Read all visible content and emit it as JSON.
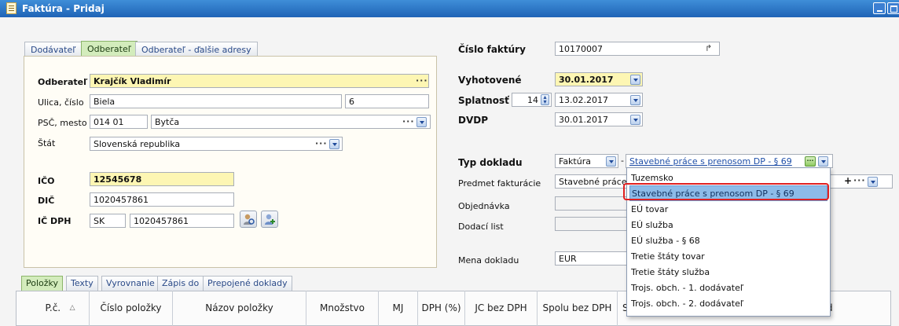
{
  "window": {
    "title": "Faktúra - Pridaj"
  },
  "tabs_top": [
    "Dodávateľ",
    "Odberateľ",
    "Odberateľ - ďalšie adresy"
  ],
  "customer": {
    "odberatel_label": "Odberateľ",
    "odberatel_value": "Krajčík Vladimír",
    "street_label": "Ulica, číslo",
    "street_value": "Biela",
    "street_number": "6",
    "psc_label": "PSČ, mesto",
    "psc_value": "014 01",
    "city_value": "Bytča",
    "country_label": "Štát",
    "country_value": "Slovenská republika",
    "ico_label": "IČO",
    "ico_value": "12545678",
    "dic_label": "DIČ",
    "dic_value": "1020457861",
    "icdph_label": "IČ DPH",
    "icdph_prefix": "SK",
    "icdph_value": "1020457861"
  },
  "invoice": {
    "number_label": "Číslo faktúry",
    "number_value": "10170007",
    "issued_label": "Vyhotovené",
    "issued_value": "30.01.2017",
    "due_label": "Splatnosť",
    "due_days": "14",
    "due_value": "13.02.2017",
    "dvdp_label": "DVDP",
    "dvdp_value": "30.01.2017",
    "doc_type_label": "Typ dokladu",
    "doc_type_value": "Faktúra",
    "doc_subtype_value": "Stavebné práce s prenosom DP - § 69",
    "subject_label": "Predmet fakturácie",
    "subject_value": "Stavebné práce s",
    "order_label": "Objednávka",
    "delivery_label": "Dodací list",
    "currency_label": "Mena dokladu",
    "currency_value": "EUR"
  },
  "dropdown": {
    "items": [
      "Tuzemsko",
      "Stavebné práce s prenosom DP - § 69",
      "EÚ tovar",
      "EÚ služba",
      "EÚ služba - § 68",
      "Tretie štáty tovar",
      "Tretie štáty služba",
      "Trojs. obch. - 1. dodávateľ",
      "Trojs. obch. - 2. dodávateľ"
    ],
    "selected_index": 1
  },
  "tabs_bottom": [
    "Položky",
    "Texty",
    "Vyrovnanie",
    "Zápis do",
    "Prepojené doklady"
  ],
  "grid_headers": [
    "P.č.",
    "Číslo položky",
    "Názov položky",
    "Množstvo",
    "MJ",
    "DPH (%)",
    "JC bez DPH",
    "Spolu bez DPH",
    "S",
    "d"
  ],
  "colors": {
    "accent_blue": "#1f63b6",
    "yellow_field": "#fdf6b3",
    "active_tab": "#d3ecbc",
    "highlight": "#8dbbe8",
    "red_ring": "#e02020"
  }
}
